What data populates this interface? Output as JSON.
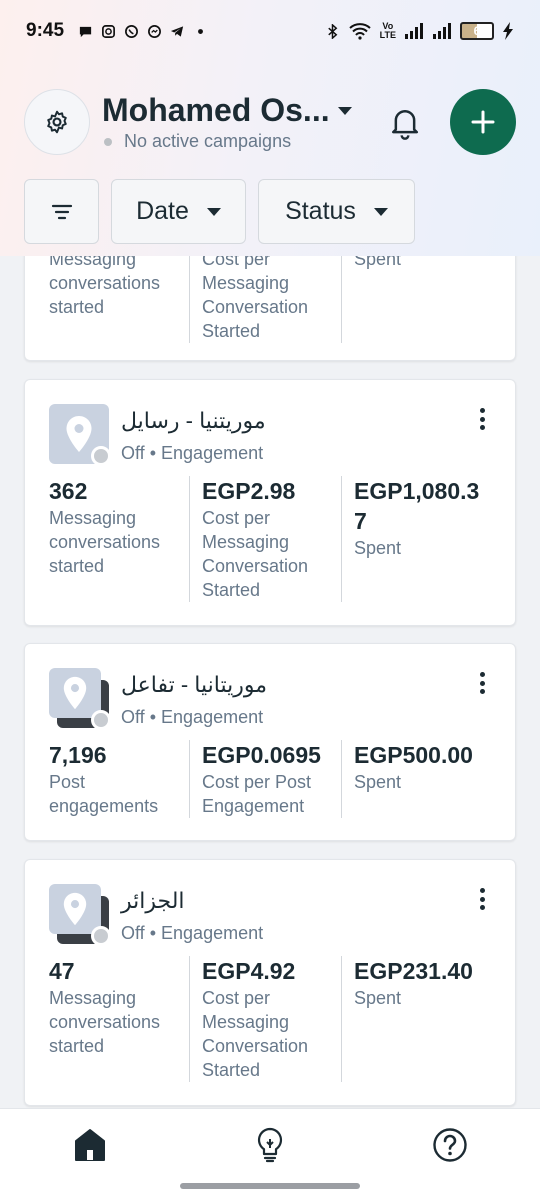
{
  "status_bar": {
    "time": "9:45",
    "left_icons": [
      "chat-bubble-icon",
      "instagram-icon",
      "whatsapp-icon",
      "messenger-icon",
      "telegram-icon",
      "dot-icon"
    ],
    "right_icons": [
      "bluetooth-icon",
      "wifi-icon",
      "volte-icon",
      "signal-icon",
      "signal-icon",
      "battery-icon",
      "charging-icon"
    ],
    "volte_label": "Vo\nLTE",
    "battery_level": "6"
  },
  "header": {
    "account_name": "Mohamed Os...",
    "account_status": "No active campaigns",
    "icons": [
      "gear-icon",
      "bell-icon",
      "plus-icon"
    ],
    "accent_color": "#0e6b4f"
  },
  "filters": {
    "items": [
      {
        "label": "",
        "icon": "filter-icon"
      },
      {
        "label": "Date",
        "icon": "caret-down-icon"
      },
      {
        "label": "Status",
        "icon": "caret-down-icon"
      }
    ]
  },
  "campaigns": [
    {
      "name": "",
      "status": "",
      "objective": "",
      "metrics": [
        {
          "value": "",
          "label": "Messaging conversations started"
        },
        {
          "value": "",
          "label": "Cost per Messaging Conversation Started"
        },
        {
          "value": "",
          "label": "Spent"
        }
      ]
    },
    {
      "name": "موريتنيا - رسايل",
      "status": "Off",
      "objective": "Engagement",
      "metrics": [
        {
          "value": "362",
          "label": "Messaging conversations started"
        },
        {
          "value": "EGP2.98",
          "label": "Cost per Messaging Conversation Started"
        },
        {
          "value": "EGP1,080.37",
          "label": "Spent"
        }
      ]
    },
    {
      "name": "موريتانيا - تفاعل",
      "status": "Off",
      "objective": "Engagement",
      "metrics": [
        {
          "value": "7,196",
          "label": "Post engagements"
        },
        {
          "value": "EGP0.0695",
          "label": "Cost per Post Engagement"
        },
        {
          "value": "EGP500.00",
          "label": "Spent"
        }
      ]
    },
    {
      "name": "الجزائر",
      "status": "Off",
      "objective": "Engagement",
      "metrics": [
        {
          "value": "47",
          "label": "Messaging conversations started"
        },
        {
          "value": "EGP4.92",
          "label": "Cost per Messaging Conversation Started"
        },
        {
          "value": "EGP231.40",
          "label": "Spent"
        }
      ]
    }
  ],
  "meta_separator": "•",
  "bottom_nav": {
    "items": [
      {
        "icon": "home-icon",
        "active": true
      },
      {
        "icon": "lightbulb-icon",
        "active": false
      },
      {
        "icon": "help-icon",
        "active": false
      }
    ]
  }
}
